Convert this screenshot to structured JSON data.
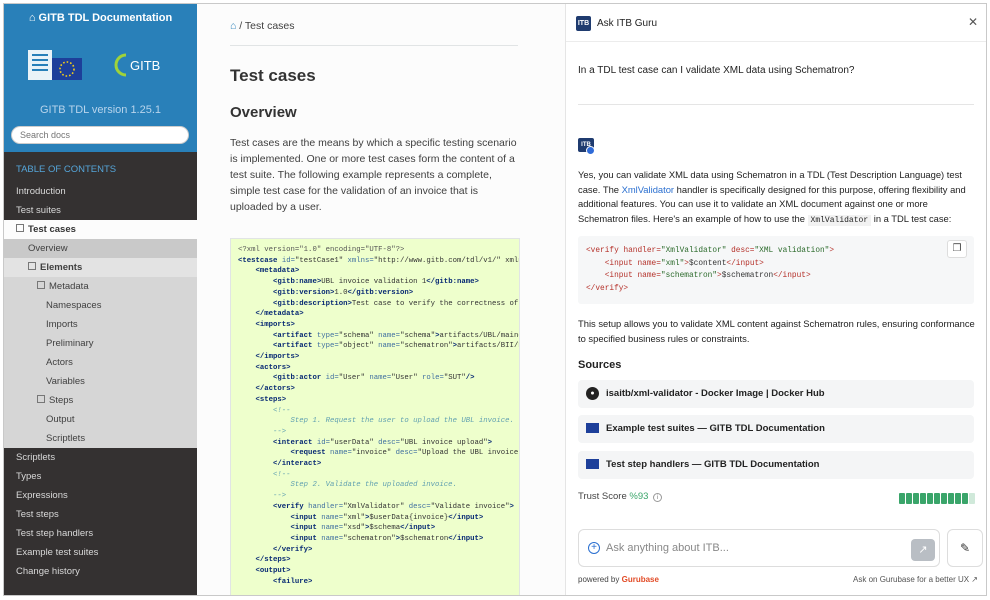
{
  "sidebar": {
    "title": "GITB TDL Documentation",
    "version": "GITB TDL version 1.25.1",
    "logo_text": "GITB",
    "search_placeholder": "Search docs",
    "toc_caption": "TABLE OF CONTENTS",
    "items_top": [
      "Introduction",
      "Test suites"
    ],
    "current": "Test cases",
    "sub": {
      "overview": "Overview",
      "elements": "Elements",
      "metadata": "Metadata",
      "namespaces": "Namespaces",
      "imports": "Imports",
      "preliminary": "Preliminary",
      "actors": "Actors",
      "variables": "Variables",
      "steps": "Steps",
      "output": "Output",
      "scriptlets": "Scriptlets"
    },
    "items_bottom": [
      "Scriptlets",
      "Types",
      "Expressions",
      "Test steps",
      "Test step handlers",
      "Example test suites",
      "Change history"
    ]
  },
  "main": {
    "breadcrumb": "Test cases",
    "title": "Test cases",
    "section": "Overview",
    "paragraph": "Test cases are the means by which a specific testing scenario is implemented. One or more test cases form the content of a test suite. The following example represents a complete, simple test case for the validation of an invoice that is uploaded by a user."
  },
  "chat": {
    "title": "Ask ITB Guru",
    "question": "In a TDL test case can I validate XML data using Schematron?",
    "answer_1": "Yes, you can validate XML data using Schematron in a TDL (Test Description Language) test case. The ",
    "answer_link": "XmlValidator",
    "answer_2": " handler is specifically designed for this purpose, offering flexibility and additional features. You can use it to validate an XML document against one or more Schematron files. Here's an example of how to use the ",
    "answer_code": "XmlValidator",
    "answer_3": " in a TDL test case:",
    "after": "This setup allows you to validate XML content against Schematron rules, ensuring conformance to specified business rules or constraints.",
    "sources_heading": "Sources",
    "sources": [
      "isaitb/xml-validator - Docker Image | Docker Hub",
      "Example test suites — GITB TDL Documentation",
      "Test step handlers — GITB TDL Documentation"
    ],
    "trust_label": "Trust Score",
    "trust_value": "%93",
    "trust_bars_on": 10,
    "trust_bars_total": 11,
    "input_placeholder": "Ask anything about ITB...",
    "powered_by": "powered by",
    "powered_brand": "Gurubase",
    "ask_gurubase": "Ask on Gurubase for a better UX ↗"
  },
  "colors": {
    "sidebar_top": "#2980b9",
    "sidebar_bg": "#343131",
    "code_bg": "#eeffcc",
    "trust_green": "#3aa56a",
    "brand_orange": "#e24b26"
  }
}
